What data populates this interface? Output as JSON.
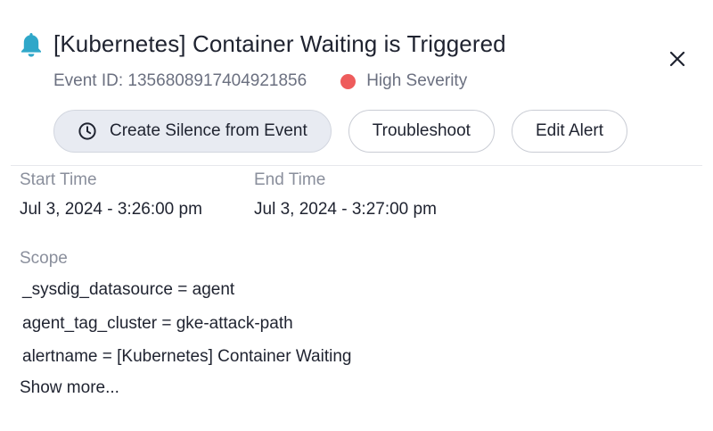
{
  "event": {
    "title": "[Kubernetes] Container Waiting is Triggered",
    "event_id_text": "Event ID: 1356808917404921856",
    "severity_label": "High Severity",
    "severity_color": "#ee5c5c",
    "bell_color": "#2fa7c9",
    "icons": {
      "bell": "bell-icon",
      "close": "close-icon",
      "clock": "clock-icon",
      "severity": "severity-dot-icon"
    }
  },
  "actions": {
    "create_silence": "Create Silence from Event",
    "troubleshoot": "Troubleshoot",
    "edit_alert": "Edit Alert"
  },
  "times": {
    "start_label": "Start Time",
    "start_value": "Jul 3, 2024 - 3:26:00 pm",
    "end_label": "End Time",
    "end_value": "Jul 3, 2024 - 3:27:00 pm"
  },
  "scope": {
    "label": "Scope",
    "items": [
      "_sysdig_datasource = agent",
      "agent_tag_cluster = gke-attack-path",
      "alertname = [Kubernetes] Container Waiting"
    ],
    "show_more": "Show more..."
  }
}
